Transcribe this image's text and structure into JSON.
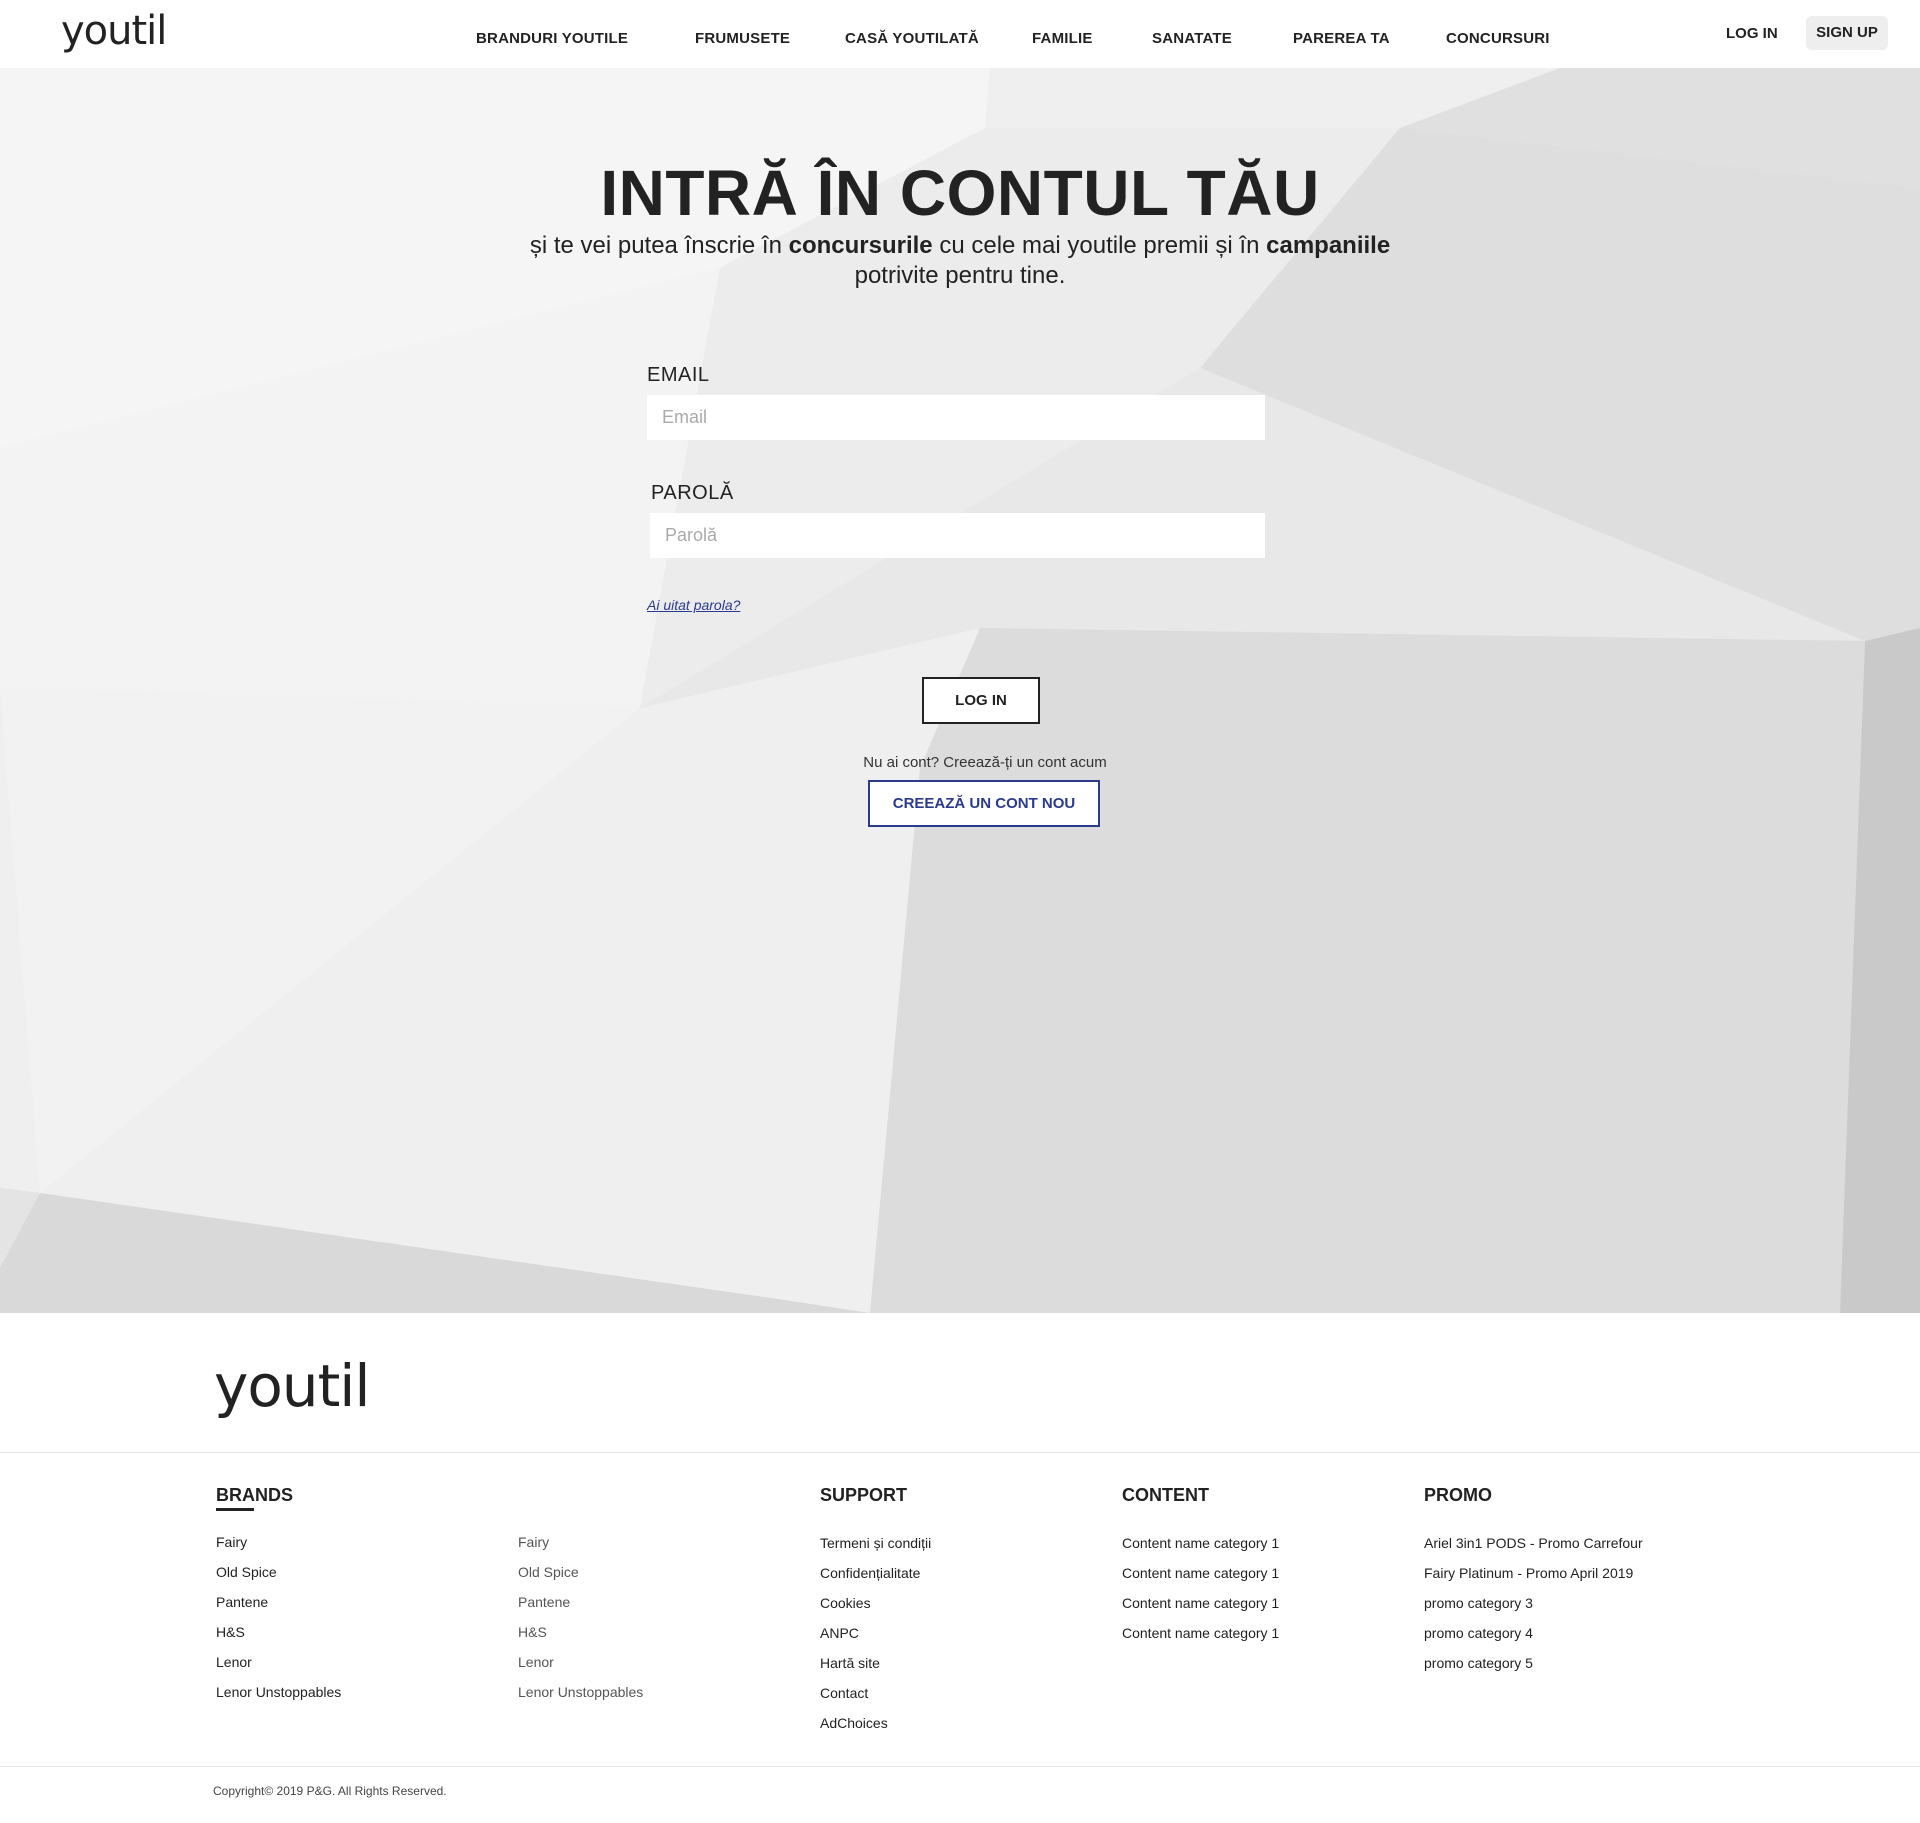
{
  "header": {
    "logo": "youtil",
    "nav": [
      {
        "label": "BRANDURI YOUTILE"
      },
      {
        "label": "FRUMUSETE"
      },
      {
        "label": "CASĂ YOUTILATĂ"
      },
      {
        "label": "FAMILIE"
      },
      {
        "label": "SANATATE"
      },
      {
        "label": "PAREREA TA"
      },
      {
        "label": "CONCURSURI"
      }
    ],
    "login_label": "LOG IN",
    "signup_label": "SIGN UP"
  },
  "hero": {
    "title": "INTRĂ ÎN CONTUL TĂU",
    "subtitle_part1": "și te vei putea înscrie în ",
    "subtitle_bold1": "concursurile",
    "subtitle_part2": " cu cele mai youtile premii și în ",
    "subtitle_bold2": "campaniile",
    "subtitle_part3": " potrivite pentru tine."
  },
  "form": {
    "email_label": "EMAIL",
    "email_placeholder": "Email",
    "email_value": "",
    "password_label": "PAROLĂ",
    "password_placeholder": "Parolă",
    "password_value": "",
    "forgot_label": "Ai uitat parola?",
    "login_button": "LOG IN",
    "no_account_text": "Nu ai cont?  Creează-ți un cont acum",
    "create_button": "CREEAZĂ UN CONT NOU"
  },
  "footer": {
    "logo": "youtil",
    "brands": {
      "title": "BRANDS",
      "col1": [
        "Fairy",
        "Old Spice",
        "Pantene",
        "H&S",
        "Lenor",
        "Lenor Unstoppables"
      ],
      "col2": [
        "Fairy",
        "Old Spice",
        "Pantene",
        "H&S",
        "Lenor",
        "Lenor Unstoppables"
      ]
    },
    "support": {
      "title": "SUPPORT",
      "items": [
        "Termeni și condiții",
        "Confidențialitate",
        "Cookies",
        "ANPC",
        "Hartă site",
        "Contact",
        "AdChoices"
      ]
    },
    "content": {
      "title": "CONTENT",
      "items": [
        "Content name category 1",
        "Content name category 1",
        "Content name category 1",
        "Content name category 1"
      ]
    },
    "promo": {
      "title": "PROMO",
      "items": [
        "Ariel 3in1 PODS - Promo Carrefour",
        "Fairy Platinum - Promo April 2019",
        "promo  category 3",
        "promo  category 4",
        "promo  category 5"
      ]
    },
    "copyright": "Copyright© 2019 P&G. All Rights Reserved."
  },
  "colors": {
    "accent": "#2a3a8c",
    "text": "#222222",
    "hero_bg": "#e6e6e6"
  }
}
